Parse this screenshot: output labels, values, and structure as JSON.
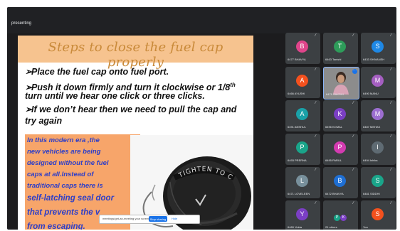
{
  "app": {
    "presenting_label": "presenting"
  },
  "slide": {
    "title": "Steps to close the fuel cap properly",
    "bullets": [
      "Place the fuel cap onto fuel port.",
      "Push it down firmly and turn it clockwise or 1/8",
      "turn  until we hear one click or three clicks.",
      "If we don’t hear then we need to pull the cap and",
      "try again"
    ],
    "bullet2_sup": "th",
    "box_lines": [
      "In this modern era ,the",
      "new vehicles are being",
      "designed without the fuel",
      "caps at all.Instead of",
      "traditional caps there is",
      "self-latching seal door",
      "that prevents the v",
      "from escaping."
    ],
    "cap_text": "TIGHTEN TO CLICK"
  },
  "toast": {
    "text": "meetings/get-an-meeting your screen",
    "button": "Stop sharing",
    "dismiss": "Hide"
  },
  "participants": [
    {
      "initial": "B",
      "name": "6477 BHAVYA",
      "color": "#e0458b"
    },
    {
      "initial": "T",
      "name": "6463 Tanishi",
      "color": "#2e9c5a"
    },
    {
      "initial": "S",
      "name": "6433 SHIVANSH",
      "color": "#1e88e5"
    },
    {
      "initial": "A",
      "name": "6466 AYUSHI",
      "color": "#f4511e"
    },
    {
      "initial": "",
      "name": "6479 SAKSHI",
      "color": "#8c8c8c"
    },
    {
      "initial": "M",
      "name": "6490 MANU",
      "color": "#a55fc1"
    },
    {
      "initial": "A",
      "name": "6491 ANSHUL",
      "color": "#1aa1a8"
    },
    {
      "initial": "K",
      "name": "6496 KOMAL",
      "color": "#7b3fc4"
    },
    {
      "initial": "M",
      "name": "6487 MEHAK",
      "color": "#9c6ed0"
    },
    {
      "initial": "P",
      "name": "6493 PRERNA",
      "color": "#1aa58a"
    },
    {
      "initial": "P",
      "name": "6495 PARUL",
      "color": "#d33bb0"
    },
    {
      "initial": "I",
      "name": "6494 Ishika",
      "color": "#5f6b73"
    },
    {
      "initial": "L",
      "name": "6471 LOVELEEN",
      "color": "#78909c"
    },
    {
      "initial": "B",
      "name": "6472 BHAVYA",
      "color": "#1e6fd4"
    },
    {
      "initial": "S",
      "name": "6481 SIDDHI",
      "color": "#1aa58a"
    },
    {
      "initial": "Y",
      "name": "6469 Yukta",
      "color": "#7b3fc4"
    },
    {
      "initial": "21",
      "name": "21 others",
      "color": "#3c4043"
    },
    {
      "initial": "S",
      "name": "You",
      "color": "#f4511e"
    }
  ],
  "others_avatars": [
    "P",
    "K"
  ]
}
